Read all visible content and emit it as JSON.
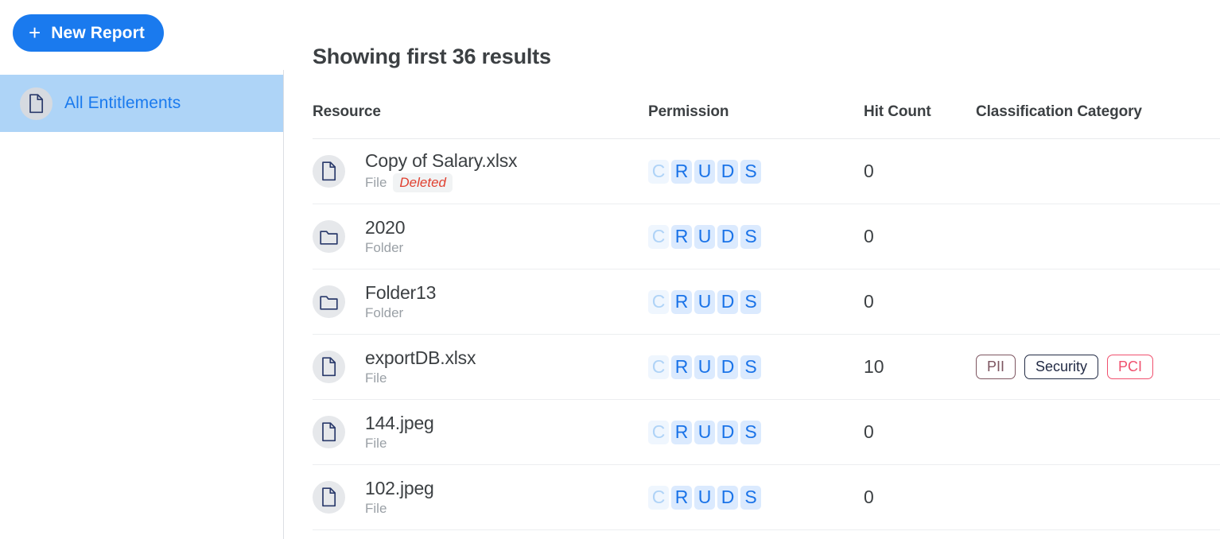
{
  "sidebar": {
    "new_report_button": {
      "label": "New Report",
      "icon": "plus-icon"
    },
    "items": [
      {
        "label": "All Entitlements",
        "icon": "file-icon",
        "selected": true
      }
    ]
  },
  "main": {
    "results_title": "Showing first 36 results",
    "table": {
      "columns": [
        "Resource",
        "Permission",
        "Hit Count",
        "Classification Category"
      ],
      "permission_letters": [
        "C",
        "R",
        "U",
        "D",
        "S"
      ],
      "rows": [
        {
          "icon": "file-icon",
          "name": "Copy of Salary.xlsx",
          "type": "File",
          "status": "Deleted",
          "permissions": {
            "C": false,
            "R": true,
            "U": true,
            "D": true,
            "S": true
          },
          "hit_count": "0",
          "categories": []
        },
        {
          "icon": "folder-icon",
          "name": "2020",
          "type": "Folder",
          "status": "",
          "permissions": {
            "C": false,
            "R": true,
            "U": true,
            "D": true,
            "S": true
          },
          "hit_count": "0",
          "categories": []
        },
        {
          "icon": "folder-icon",
          "name": "Folder13",
          "type": "Folder",
          "status": "",
          "permissions": {
            "C": false,
            "R": true,
            "U": true,
            "D": true,
            "S": true
          },
          "hit_count": "0",
          "categories": []
        },
        {
          "icon": "file-icon",
          "name": "exportDB.xlsx",
          "type": "File",
          "status": "",
          "permissions": {
            "C": false,
            "R": true,
            "U": true,
            "D": true,
            "S": true
          },
          "hit_count": "10",
          "categories": [
            {
              "label": "PII",
              "style": "pii"
            },
            {
              "label": "Security",
              "style": "security"
            },
            {
              "label": "PCI",
              "style": "pci"
            }
          ]
        },
        {
          "icon": "file-icon",
          "name": "144.jpeg",
          "type": "File",
          "status": "",
          "permissions": {
            "C": false,
            "R": true,
            "U": true,
            "D": true,
            "S": true
          },
          "hit_count": "0",
          "categories": []
        },
        {
          "icon": "file-icon",
          "name": "102.jpeg",
          "type": "File",
          "status": "",
          "permissions": {
            "C": false,
            "R": true,
            "U": true,
            "D": true,
            "S": true
          },
          "hit_count": "0",
          "categories": []
        }
      ]
    }
  },
  "colors": {
    "accent": "#1a7aee",
    "sidebar_selected_bg": "#aed4f7",
    "permission_active": "#1a73e8",
    "permission_inactive": "#afd3f7",
    "deleted_text": "#e04030",
    "tag_pii": "#7d5560",
    "tag_security": "#222b45",
    "tag_pci": "#f0506e"
  }
}
